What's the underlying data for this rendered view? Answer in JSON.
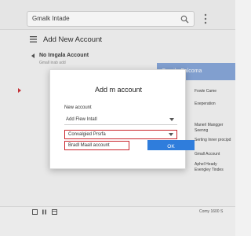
{
  "search": {
    "text": "Gmalk Intade"
  },
  "header": {
    "title": "Add New Account"
  },
  "background": {
    "title": "No Imgala Account",
    "subtitle": "Gmall inab add"
  },
  "right_panel": {
    "banner": "Gmail - Falcoma",
    "items": [
      "Fowle Came",
      "Exeperation",
      "Manerl Mangger Seenng",
      "Serting Inner procipd",
      "Gmall Account",
      "Aphel Heady Evengley Tindes"
    ]
  },
  "modal": {
    "title": "Add m account",
    "field_label": "New account",
    "select1_value": "Add Flew Intatl",
    "select2_value": "Convalgied Prsrfa",
    "link_text": "Bradl Maall account",
    "ok_label": "OK"
  },
  "status": {
    "text": "Comy 1600 S"
  },
  "colors": {
    "accent_blue": "#2f7ddc",
    "highlight_red": "#c9252c",
    "banner_blue": "#7fa1d6"
  }
}
